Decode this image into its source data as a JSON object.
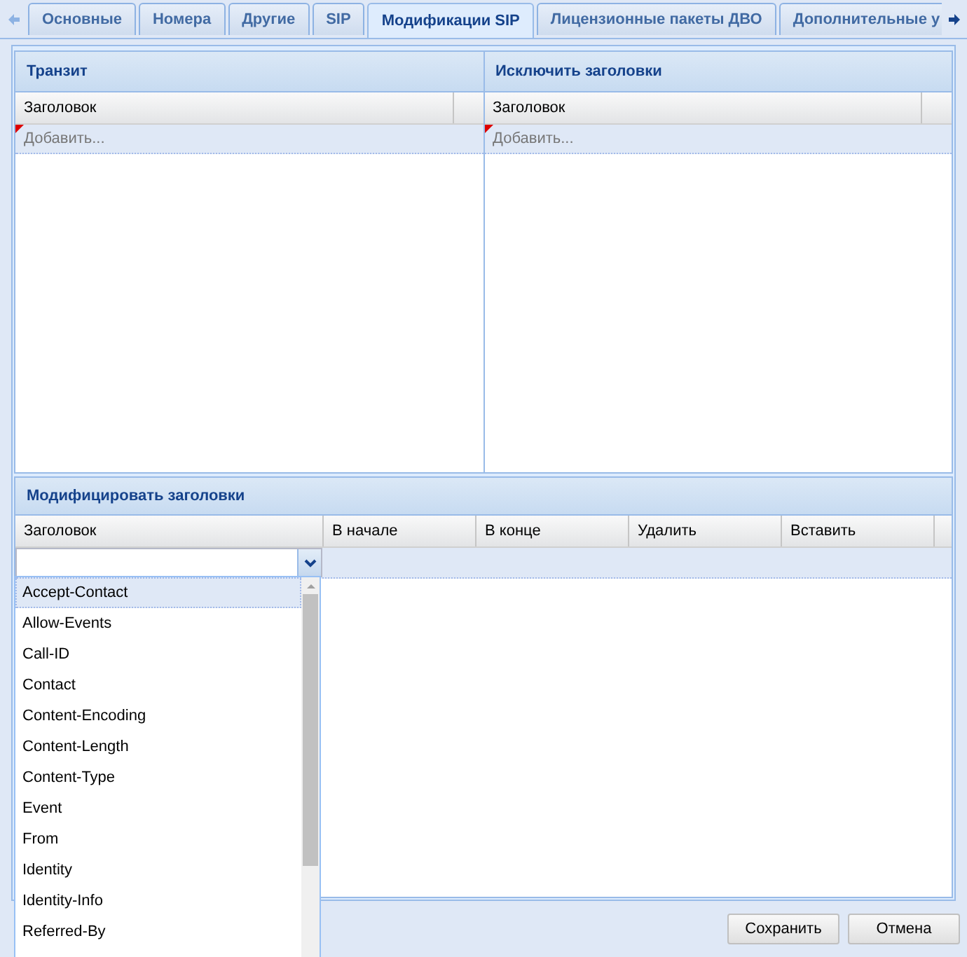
{
  "tabs": [
    {
      "label": "Основные",
      "selected": false
    },
    {
      "label": "Номера",
      "selected": false
    },
    {
      "label": "Другие",
      "selected": false
    },
    {
      "label": "SIP",
      "selected": false
    },
    {
      "label": "Модификации SIP",
      "selected": true
    },
    {
      "label": "Лицензионные пакеты ДВО",
      "selected": false
    },
    {
      "label": "Дополнительные у",
      "selected": false
    }
  ],
  "transit": {
    "title": "Транзит",
    "column": "Заголовок",
    "add_placeholder": "Добавить..."
  },
  "exclude": {
    "title": "Исключить заголовки",
    "column": "Заголовок",
    "add_placeholder": "Добавить..."
  },
  "modify": {
    "title": "Модифицировать заголовки",
    "columns": [
      "Заголовок",
      "В начале",
      "В конце",
      "Удалить",
      "Вставить"
    ],
    "dropdown": {
      "options": [
        {
          "label": "Accept-Contact",
          "selected": true
        },
        {
          "label": "Allow-Events",
          "selected": false
        },
        {
          "label": "Call-ID",
          "selected": false
        },
        {
          "label": "Contact",
          "selected": false
        },
        {
          "label": "Content-Encoding",
          "selected": false
        },
        {
          "label": "Content-Length",
          "selected": false
        },
        {
          "label": "Content-Type",
          "selected": false
        },
        {
          "label": "Event",
          "selected": false
        },
        {
          "label": "From",
          "selected": false
        },
        {
          "label": "Identity",
          "selected": false
        },
        {
          "label": "Identity-Info",
          "selected": false
        },
        {
          "label": "Referred-By",
          "selected": false
        }
      ]
    }
  },
  "buttons": [
    "Сохранить",
    "Отмена"
  ]
}
